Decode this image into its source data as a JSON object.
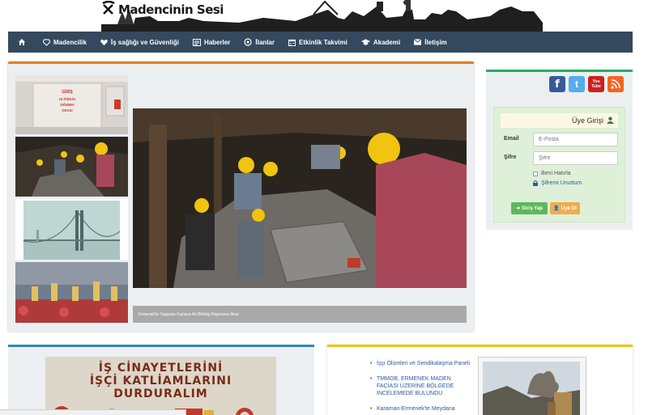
{
  "header": {
    "site_title": "Madencinin Sesi"
  },
  "nav": {
    "items": [
      {
        "label": "",
        "icon": "home-icon"
      },
      {
        "label": "Madencilik",
        "icon": "diamond-icon"
      },
      {
        "label": "İş sağlığı ve Güvenliği",
        "icon": "heart-icon"
      },
      {
        "label": "Haberler",
        "icon": "newspaper-icon"
      },
      {
        "label": "İlanlar",
        "icon": "bullhorn-icon"
      },
      {
        "label": "Etkinlik Takvimi",
        "icon": "calendar-icon"
      },
      {
        "label": "Akademi",
        "icon": "graduation-cap-icon"
      },
      {
        "label": "İletişim",
        "icon": "envelope-icon"
      }
    ]
  },
  "slider": {
    "thumbnails": [
      {
        "sign": "GİRİŞ\n14 KİŞİLİK\nSIĞINMA\nODASI"
      },
      {
        "label": ""
      },
      {
        "label": ""
      },
      {
        "label": ""
      }
    ],
    "caption": "Ermenek'te Yaşanan Faciaya Ait Bilirkişi Raporuna İtiraz"
  },
  "social": [
    {
      "name": "facebook-icon",
      "glyph": "f",
      "color": "#3b5998"
    },
    {
      "name": "twitter-icon",
      "glyph": "t",
      "color": "#55acee"
    },
    {
      "name": "youtube-icon",
      "glyph": "You\nTube",
      "color": "#cd201f"
    },
    {
      "name": "rss-icon",
      "glyph": "",
      "color": "#f26522"
    }
  ],
  "login": {
    "title": "Üye Girişi",
    "email_label": "Email",
    "email_placeholder": "E-Posta",
    "password_label": "Şifre",
    "password_placeholder": "Şifre",
    "remember_label": "Beni Hatırla",
    "forgot_label": "Şifremi Unuttum",
    "login_button": "Giriş Yap",
    "register_button": "Üye Ol",
    "colors": {
      "login": "#5cb85c",
      "register": "#f0ad4e"
    }
  },
  "banner": {
    "line1": "İŞ CİNAYETLERİNİ",
    "line2": "İŞÇİ KATLİAMLARINI",
    "line3": "DURDURALIM"
  },
  "news": {
    "items": [
      "İşçi Ölümleri ve Sendikalaşma Paneli",
      "TMMOB, ERMENEK MADEN FACİASI ÜZERİNE BÖLGEDE İNCELEMEDE BULUNDU",
      "Karaman-Ermenek'te Meydana"
    ]
  }
}
